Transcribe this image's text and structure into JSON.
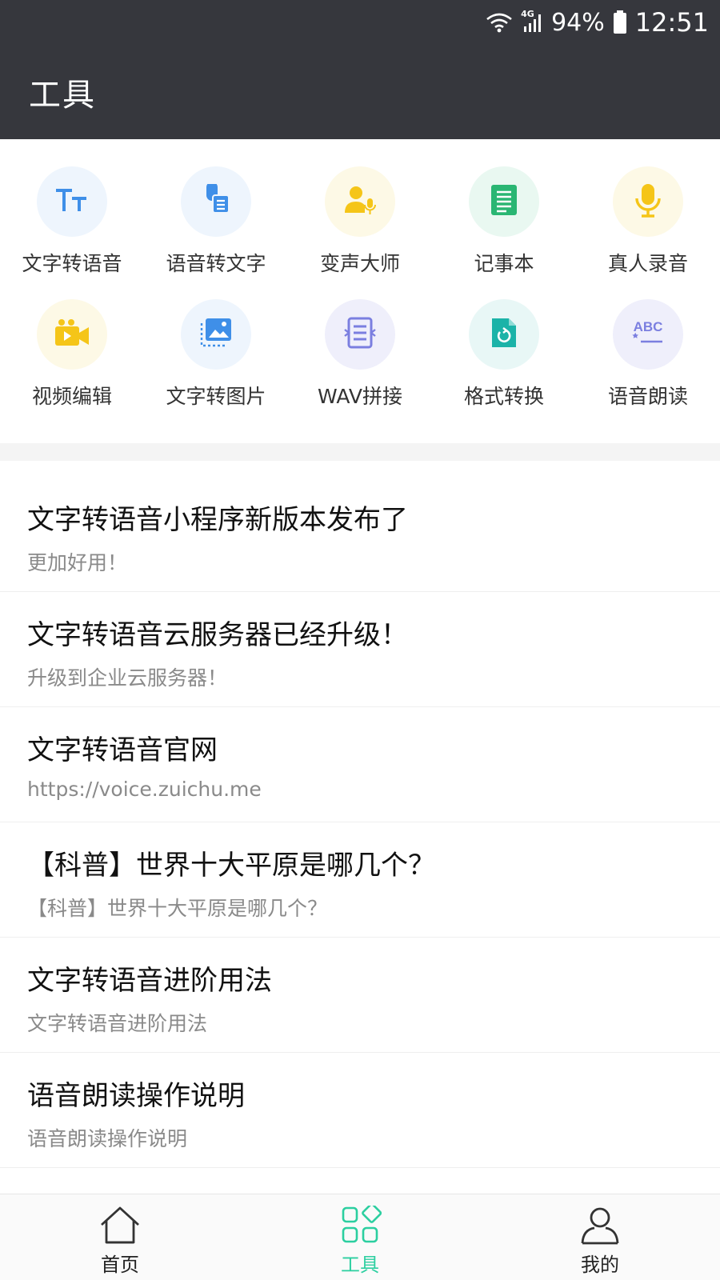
{
  "status_bar": {
    "network": "4G",
    "battery": "94%",
    "time": "12:51"
  },
  "header": {
    "title": "工具"
  },
  "tools": [
    {
      "label": "文字转语音",
      "icon": "text-size-icon",
      "bg": "#eef5fd",
      "fg": "#3f8fe8"
    },
    {
      "label": "语音转文字",
      "icon": "speech-to-text-icon",
      "bg": "#eef5fd",
      "fg": "#3f8fe8"
    },
    {
      "label": "变声大师",
      "icon": "voice-changer-icon",
      "bg": "#fdf9e6",
      "fg": "#f5c518"
    },
    {
      "label": "记事本",
      "icon": "notepad-icon",
      "bg": "#e9f8f1",
      "fg": "#2ab673"
    },
    {
      "label": "真人录音",
      "icon": "microphone-icon",
      "bg": "#fdf9e6",
      "fg": "#f5c518"
    },
    {
      "label": "视频编辑",
      "icon": "video-camera-icon",
      "bg": "#fdf9e6",
      "fg": "#f5c518"
    },
    {
      "label": "文字转图片",
      "icon": "image-icon",
      "bg": "#eef5fd",
      "fg": "#3f8fe8"
    },
    {
      "label": "WAV拼接",
      "icon": "merge-document-icon",
      "bg": "#efeffb",
      "fg": "#7b7fe0"
    },
    {
      "label": "格式转换",
      "icon": "file-convert-icon",
      "bg": "#e8f7f6",
      "fg": "#1bb3a8"
    },
    {
      "label": "语音朗读",
      "icon": "abc-reading-icon",
      "bg": "#efeffb",
      "fg": "#7b7fe0"
    }
  ],
  "news": [
    {
      "title": "文字转语音小程序新版本发布了",
      "subtitle": "更加好用！"
    },
    {
      "title": "文字转语音云服务器已经升级！",
      "subtitle": "升级到企业云服务器！"
    },
    {
      "title": "文字转语音官网",
      "subtitle": "https://voice.zuichu.me"
    },
    {
      "title": "【科普】世界十大平原是哪几个？",
      "subtitle": "【科普】世界十大平原是哪几个？"
    },
    {
      "title": "文字转语音进阶用法",
      "subtitle": "文字转语音进阶用法"
    },
    {
      "title": "语音朗读操作说明",
      "subtitle": "语音朗读操作说明"
    }
  ],
  "tabbar": {
    "items": [
      {
        "label": "首页",
        "icon": "home-icon"
      },
      {
        "label": "工具",
        "icon": "apps-icon",
        "active": true
      },
      {
        "label": "我的",
        "icon": "user-icon"
      }
    ],
    "active_color": "#2ccfa0"
  }
}
